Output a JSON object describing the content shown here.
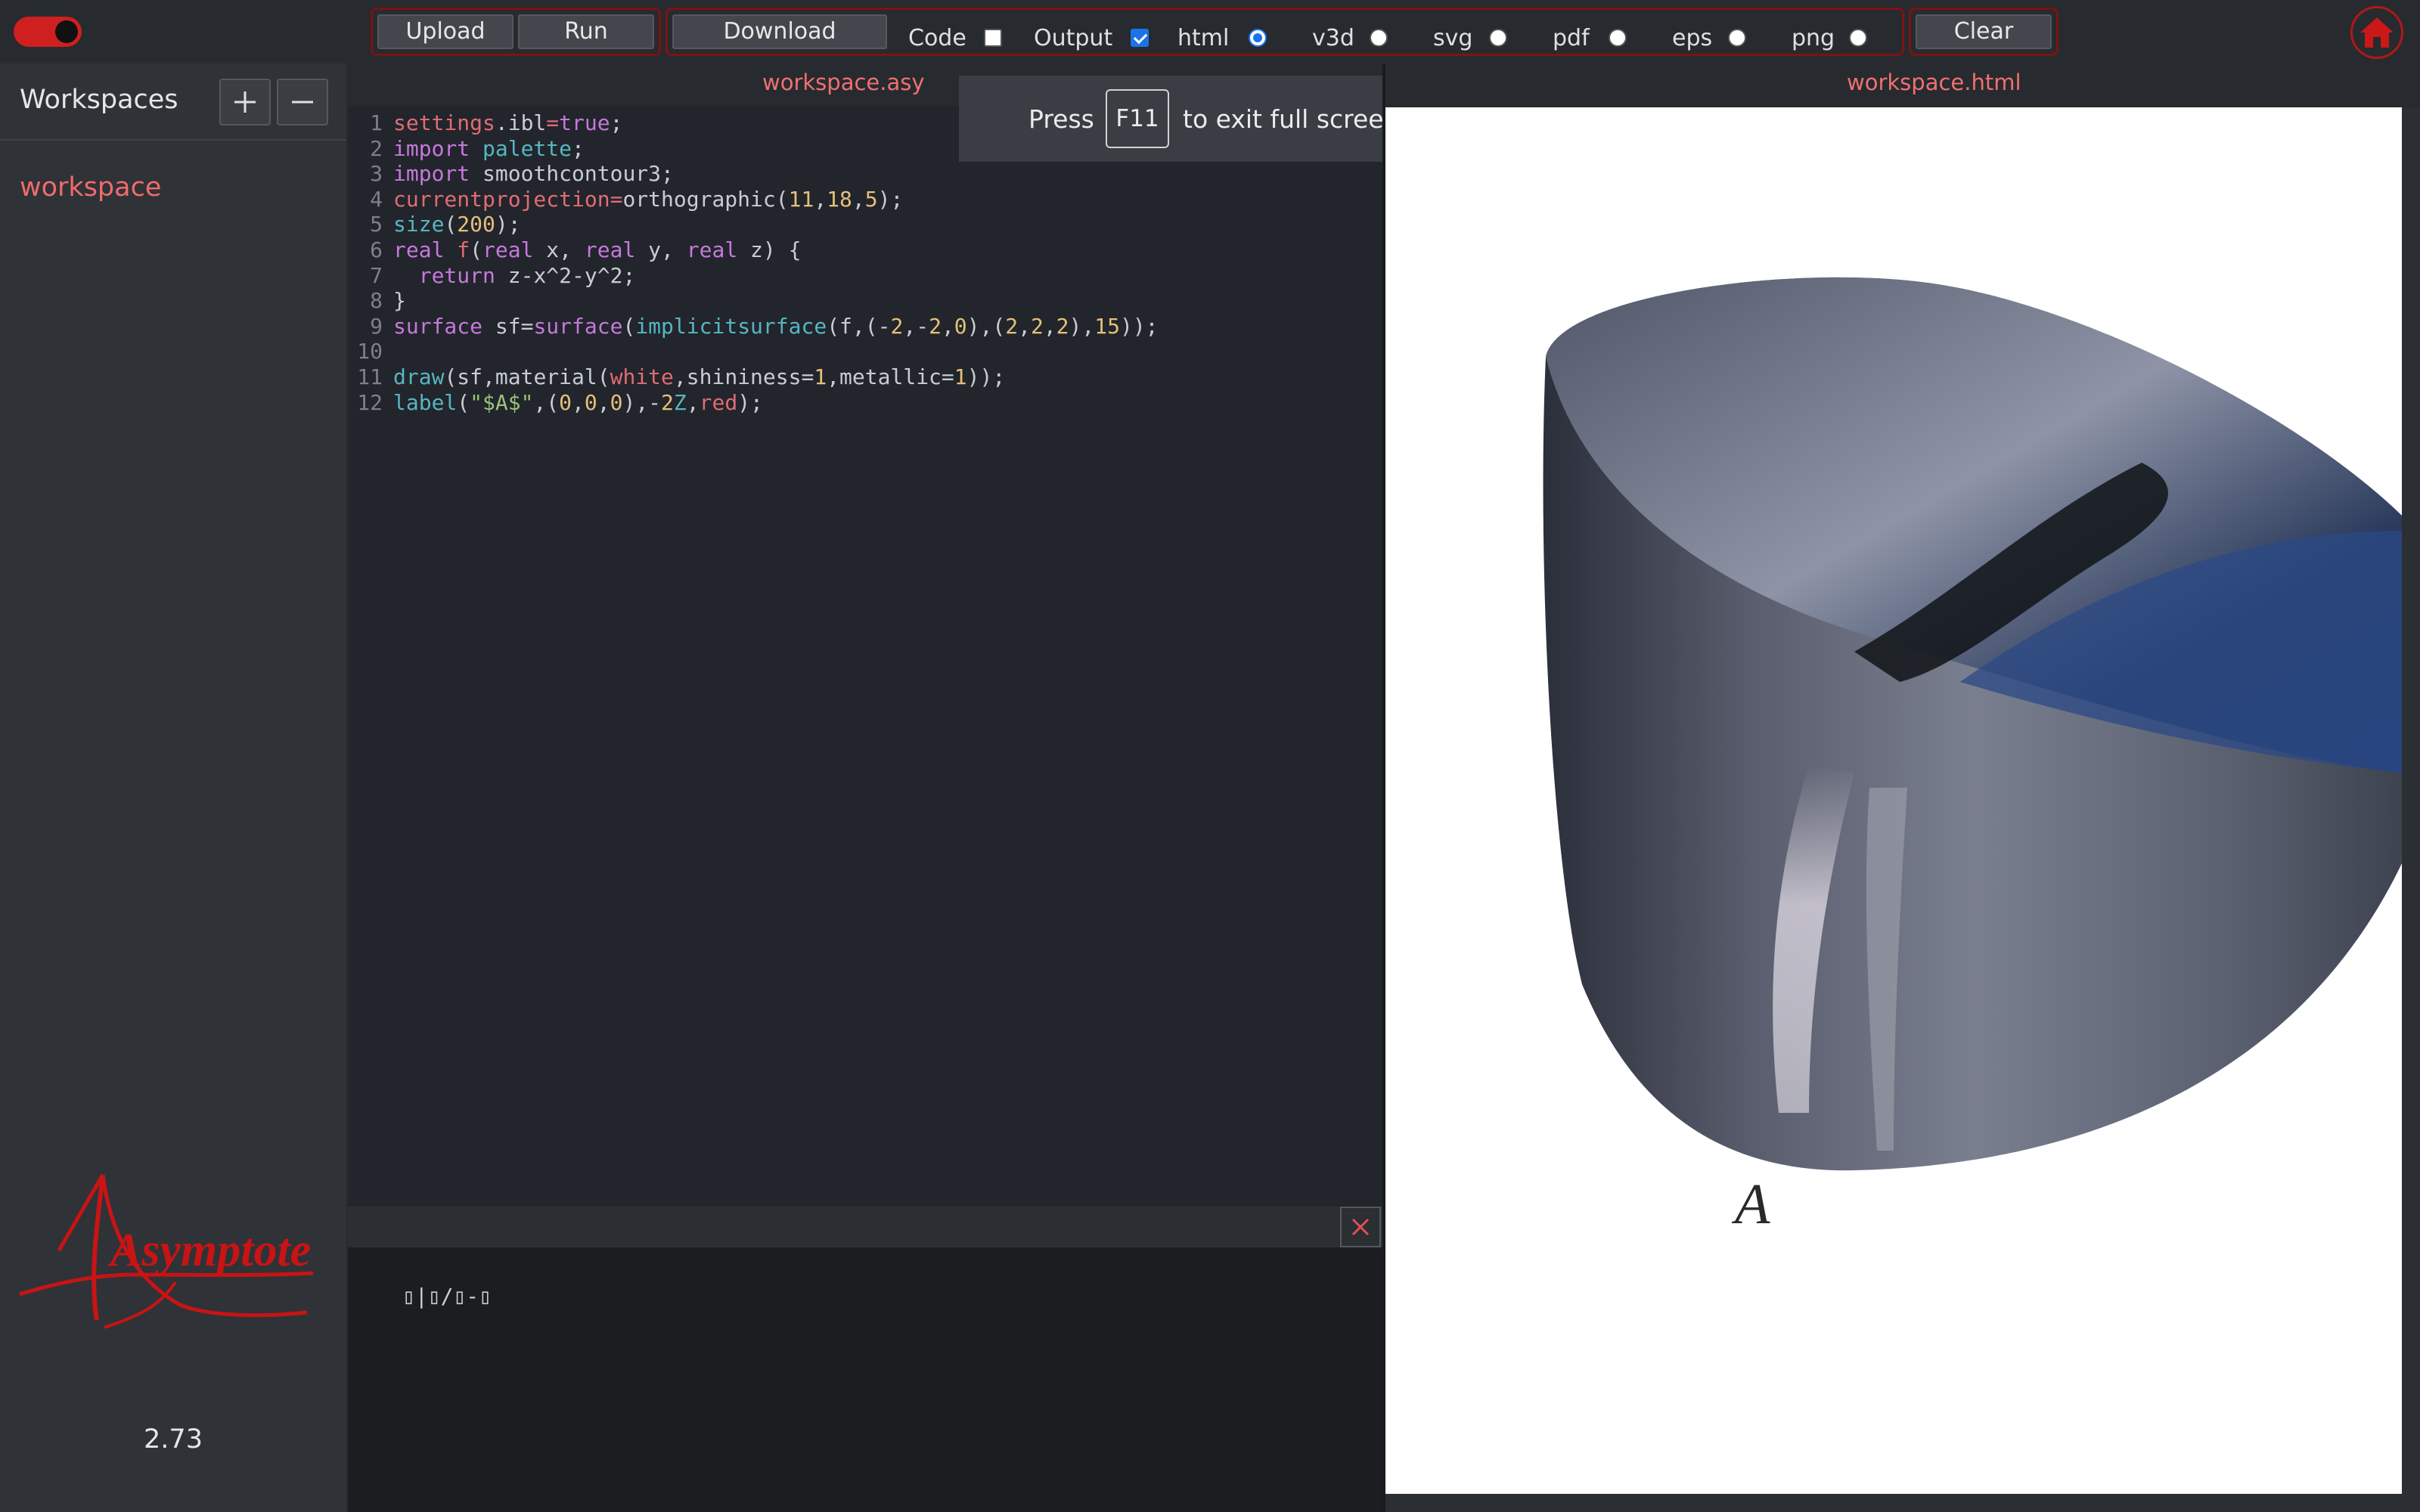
{
  "toolbar": {
    "upload_label": "Upload",
    "run_label": "Run",
    "download_label": "Download",
    "code_label": "Code",
    "code_checked": false,
    "output_label": "Output",
    "output_checked": true,
    "formats": [
      {
        "label": "html",
        "selected": true
      },
      {
        "label": "v3d",
        "selected": false
      },
      {
        "label": "svg",
        "selected": false
      },
      {
        "label": "pdf",
        "selected": false
      },
      {
        "label": "eps",
        "selected": false
      },
      {
        "label": "png",
        "selected": false
      }
    ],
    "clear_label": "Clear",
    "toggle_on": true,
    "accent_color": "#cf1f1f"
  },
  "sidebar": {
    "title": "Workspaces",
    "items": [
      {
        "label": "workspace",
        "active": true
      }
    ],
    "logo_text": "Asymptote",
    "version": "2.73"
  },
  "editor": {
    "file_name": "workspace.asy",
    "lines": [
      {
        "n": "1",
        "tokens": [
          [
            "fn",
            "settings"
          ],
          [
            "cl",
            "."
          ],
          [
            "cl",
            "ibl"
          ],
          [
            "fn",
            "="
          ],
          [
            "kw",
            "true"
          ],
          [
            "cl",
            ";"
          ]
        ]
      },
      {
        "n": "2",
        "tokens": [
          [
            "kw",
            "import"
          ],
          [
            "cl",
            " "
          ],
          [
            "bi",
            "palette"
          ],
          [
            "cl",
            ";"
          ]
        ]
      },
      {
        "n": "3",
        "tokens": [
          [
            "kw",
            "import"
          ],
          [
            "cl",
            " smoothcontour3;"
          ]
        ]
      },
      {
        "n": "4",
        "tokens": [
          [
            "fn",
            "currentprojection"
          ],
          [
            "fn",
            "="
          ],
          [
            "cl",
            "orthographic("
          ],
          [
            "nm",
            "11"
          ],
          [
            "cl",
            ","
          ],
          [
            "nm",
            "18"
          ],
          [
            "cl",
            ","
          ],
          [
            "nm",
            "5"
          ],
          [
            "cl",
            ");"
          ]
        ]
      },
      {
        "n": "5",
        "tokens": [
          [
            "bi",
            "size"
          ],
          [
            "cl",
            "("
          ],
          [
            "nm",
            "200"
          ],
          [
            "cl",
            ");"
          ]
        ]
      },
      {
        "n": "6",
        "tokens": [
          [
            "kw",
            "real"
          ],
          [
            "cl",
            " "
          ],
          [
            "fn",
            "f"
          ],
          [
            "cl",
            "("
          ],
          [
            "kw",
            "real"
          ],
          [
            "cl",
            " x, "
          ],
          [
            "kw",
            "real"
          ],
          [
            "cl",
            " y, "
          ],
          [
            "kw",
            "real"
          ],
          [
            "cl",
            " z) {"
          ]
        ]
      },
      {
        "n": "7",
        "tokens": [
          [
            "cl",
            "  "
          ],
          [
            "kw",
            "return"
          ],
          [
            "cl",
            " z-x^2-y^2;"
          ]
        ]
      },
      {
        "n": "8",
        "tokens": [
          [
            "cl",
            "}"
          ]
        ]
      },
      {
        "n": "9",
        "tokens": [
          [
            "kw",
            "surface"
          ],
          [
            "cl",
            " sf="
          ],
          [
            "kw",
            "surface"
          ],
          [
            "cl",
            "("
          ],
          [
            "bi",
            "implicitsurface"
          ],
          [
            "cl",
            "(f,(-"
          ],
          [
            "nm",
            "2"
          ],
          [
            "cl",
            ",-"
          ],
          [
            "nm",
            "2"
          ],
          [
            "cl",
            ","
          ],
          [
            "nm",
            "0"
          ],
          [
            "cl",
            "),("
          ],
          [
            "nm",
            "2"
          ],
          [
            "cl",
            ","
          ],
          [
            "nm",
            "2"
          ],
          [
            "cl",
            ","
          ],
          [
            "nm",
            "2"
          ],
          [
            "cl",
            "),"
          ],
          [
            "nm",
            "15"
          ],
          [
            "cl",
            "));"
          ]
        ]
      },
      {
        "n": "10",
        "tokens": []
      },
      {
        "n": "11",
        "tokens": [
          [
            "bi",
            "draw"
          ],
          [
            "cl",
            "(sf,material("
          ],
          [
            "fn",
            "white"
          ],
          [
            "cl",
            ",shininess="
          ],
          [
            "nm",
            "1"
          ],
          [
            "cl",
            ",metallic="
          ],
          [
            "nm",
            "1"
          ],
          [
            "cl",
            "));"
          ]
        ]
      },
      {
        "n": "12",
        "tokens": [
          [
            "bi",
            "label"
          ],
          [
            "cl",
            "("
          ],
          [
            "st",
            "\"$A$\""
          ],
          [
            "cl",
            ",("
          ],
          [
            "nm",
            "0"
          ],
          [
            "cl",
            ","
          ],
          [
            "nm",
            "0"
          ],
          [
            "cl",
            ","
          ],
          [
            "nm",
            "0"
          ],
          [
            "cl",
            "),-"
          ],
          [
            "nm",
            "2"
          ],
          [
            "bi",
            "Z"
          ],
          [
            "cl",
            ","
          ],
          [
            "fn",
            "red"
          ],
          [
            "cl",
            ");"
          ]
        ]
      }
    ],
    "output_text": "▯|▯/▯-▯"
  },
  "fullscreen_toast": {
    "press": "Press",
    "key": "F11",
    "rest": "to exit full screen"
  },
  "preview": {
    "file_name": "workspace.html",
    "label": "A"
  }
}
